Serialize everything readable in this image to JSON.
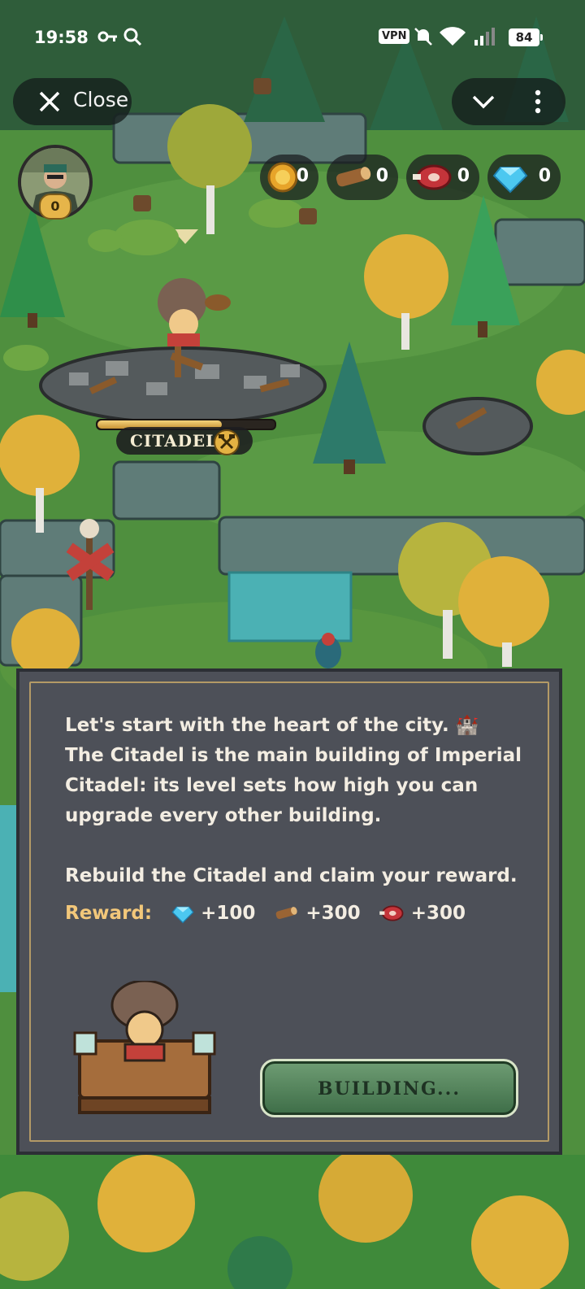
{
  "status_bar": {
    "time": "19:58",
    "vpn": "VPN",
    "battery": "84",
    "icons": [
      "key-icon",
      "search-icon",
      "mute-icon",
      "wifi-icon",
      "signal-icon"
    ]
  },
  "controls": {
    "close_label": "Close",
    "collapse_icon": "chevron-down-icon",
    "more_icon": "more-vertical-icon"
  },
  "player": {
    "level": "0"
  },
  "resources": [
    {
      "name": "gold",
      "icon": "gold-coin-icon",
      "value": "0"
    },
    {
      "name": "wood",
      "icon": "wood-log-icon",
      "value": "0"
    },
    {
      "name": "meat",
      "icon": "meat-icon",
      "value": "0"
    },
    {
      "name": "gems",
      "icon": "diamond-icon",
      "value": "0"
    }
  ],
  "map": {
    "citadel_label": "CITADEL",
    "citadel_progress": 0.7
  },
  "dialog": {
    "line1": "Let's start with the heart of the city. 🏰",
    "line2": "The Citadel is the main building of Imperial Citadel: its level sets how high you can upgrade every other building.",
    "line3": "Rebuild the Citadel and claim your reward.",
    "reward_label": "Reward:",
    "rewards": [
      {
        "icon": "diamond-icon",
        "amount": "+100"
      },
      {
        "icon": "wood-log-icon",
        "amount": "+300"
      },
      {
        "icon": "meat-icon",
        "amount": "+300"
      }
    ],
    "button_label": "BUILDING..."
  },
  "colors": {
    "grass": "#4f8f3e",
    "dialog_bg": "#4d5058",
    "dialog_border": "#b49a66",
    "button_green": "#4e7f57",
    "reward_label": "#f2c77a"
  }
}
